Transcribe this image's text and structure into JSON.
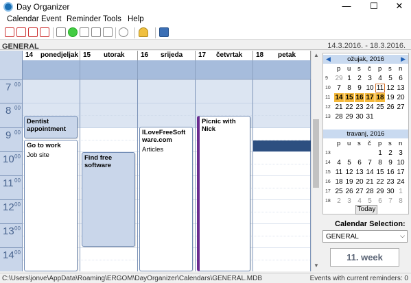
{
  "window": {
    "title": "Day Organizer"
  },
  "menu": [
    "Calendar",
    "Event",
    "Reminder",
    "Tools",
    "Help"
  ],
  "header": {
    "calendar_name": "GENERAL",
    "date_range": "14.3.2016. - 18.3.2016."
  },
  "days": [
    {
      "num": "14",
      "name": "ponedjeljak"
    },
    {
      "num": "15",
      "name": "utorak"
    },
    {
      "num": "16",
      "name": "srijeda"
    },
    {
      "num": "17",
      "name": "četvrtak"
    },
    {
      "num": "18",
      "name": "petak"
    }
  ],
  "hours": [
    {
      "h": "7",
      "m": "00"
    },
    {
      "h": "8",
      "m": "00"
    },
    {
      "h": "9",
      "m": "00"
    },
    {
      "h": "10",
      "m": "00"
    },
    {
      "h": "11",
      "m": "00"
    },
    {
      "h": "12",
      "m": "00"
    },
    {
      "h": "13",
      "m": "00"
    },
    {
      "h": "14",
      "m": "00"
    }
  ],
  "events": {
    "dentist": {
      "title": "Dentist appointment"
    },
    "work": {
      "title": "Go to work",
      "subtitle": "Job site"
    },
    "software": {
      "title": "Find free software"
    },
    "ilove": {
      "title": "ILoveFreeSoftware.com",
      "subtitle": "Articles"
    },
    "picnic": {
      "title": "Picnic with Nick"
    }
  },
  "minical": {
    "march": {
      "title": "ožujak, 2016",
      "dow": [
        "p",
        "u",
        "s",
        "č",
        "p",
        "s",
        "n"
      ],
      "weeks": [
        {
          "wk": "9",
          "days": [
            "29",
            "1",
            "2",
            "3",
            "4",
            "5",
            "6"
          ]
        },
        {
          "wk": "10",
          "days": [
            "7",
            "8",
            "9",
            "10",
            "11",
            "12",
            "13"
          ]
        },
        {
          "wk": "11",
          "days": [
            "14",
            "15",
            "16",
            "17",
            "18",
            "19",
            "20"
          ]
        },
        {
          "wk": "12",
          "days": [
            "21",
            "22",
            "23",
            "24",
            "25",
            "26",
            "27"
          ]
        },
        {
          "wk": "13",
          "days": [
            "28",
            "29",
            "30",
            "31",
            "",
            "",
            ""
          ]
        }
      ]
    },
    "april": {
      "title": "travanj, 2016",
      "dow": [
        "p",
        "u",
        "s",
        "č",
        "p",
        "s",
        "n"
      ],
      "weeks": [
        {
          "wk": "13",
          "days": [
            "",
            "",
            "",
            "",
            "1",
            "2",
            "3"
          ]
        },
        {
          "wk": "14",
          "days": [
            "4",
            "5",
            "6",
            "7",
            "8",
            "9",
            "10"
          ]
        },
        {
          "wk": "15",
          "days": [
            "11",
            "12",
            "13",
            "14",
            "15",
            "16",
            "17"
          ]
        },
        {
          "wk": "16",
          "days": [
            "18",
            "19",
            "20",
            "21",
            "22",
            "23",
            "24"
          ]
        },
        {
          "wk": "17",
          "days": [
            "25",
            "26",
            "27",
            "28",
            "29",
            "30",
            "1"
          ]
        },
        {
          "wk": "18",
          "days": [
            "2",
            "3",
            "4",
            "5",
            "6",
            "7",
            "8"
          ]
        }
      ]
    },
    "today_label": "Today"
  },
  "selection": {
    "label": "Calendar Selection:",
    "value": "GENERAL"
  },
  "week": {
    "label": "11. week"
  },
  "status": {
    "path": "C:\\Users\\jonve\\AppData\\Roaming\\ERGOM\\DayOrganizer\\Calendars\\GENERAL.MDB",
    "reminders": "Events with current reminders: 0"
  },
  "colors": {
    "accent": "#1e5fb5",
    "selected_day": "#f5b93a",
    "allday_band": "#a6bcdc",
    "timecol": "#c9d6ea",
    "marked_slot": "#2d4f80",
    "picnic_bar": "#6a2b8f"
  }
}
